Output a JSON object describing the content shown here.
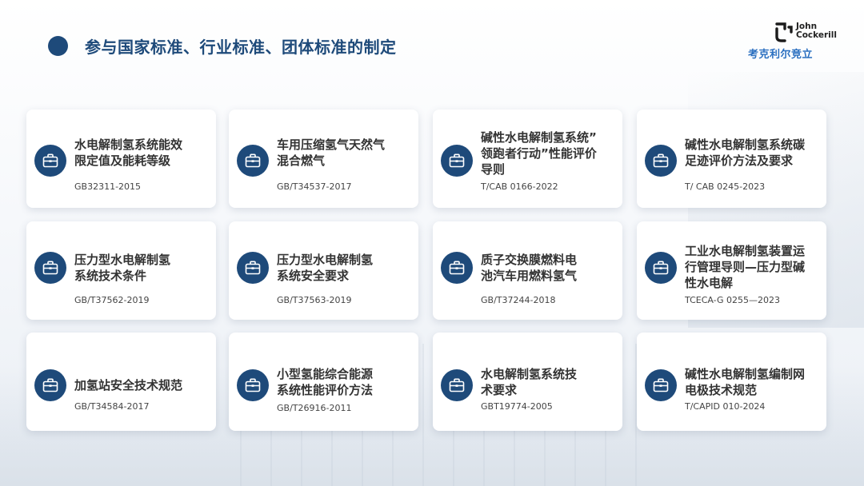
{
  "header": {
    "title": "参与国家标准、行业标准、团体标准的制定"
  },
  "logo": {
    "name_en": "John\nCockerill",
    "name_cn": "考克利尔竞立"
  },
  "colors": {
    "primary": "#1e4a7a",
    "logo_blue": "#2a6fc0"
  },
  "icon": "briefcase-icon",
  "standards": [
    {
      "title": "水电解制氢系统能效\n限定值及能耗等级",
      "code": "GB32311-2015"
    },
    {
      "title": "车用压缩氢气天然气\n混合燃气",
      "code": "GB/T34537-2017"
    },
    {
      "title": "碱性水电解制氢系统”\n领跑者行动”性能评价\n导则",
      "code": "T/CAB 0166-2022"
    },
    {
      "title": "碱性水电解制氢系统碳\n足迹评价方法及要求",
      "code": "T/ CAB 0245-2023"
    },
    {
      "title": "压力型水电解制氢\n系统技术条件",
      "code": "GB/T37562-2019"
    },
    {
      "title": "压力型水电解制氢\n系统安全要求",
      "code": "GB/T37563-2019"
    },
    {
      "title": "质子交换膜燃料电\n池汽车用燃料氢气",
      "code": "GB/T37244-2018"
    },
    {
      "title": "工业水电解制氢装置运\n行管理导则—压力型碱\n性水电解",
      "code": "TCECA-G 0255—2023"
    },
    {
      "title": "加氢站安全技术规范",
      "code": "GB/T34584-2017"
    },
    {
      "title": "小型氢能综合能源\n系统性能评价方法",
      "code": "GB/T26916-2011"
    },
    {
      "title": "水电解制氢系统技\n术要求",
      "code": "GBT19774-2005"
    },
    {
      "title": "碱性水电解制氢编制网\n电极技术规范",
      "code": "T/CAPID 010-2024"
    }
  ]
}
